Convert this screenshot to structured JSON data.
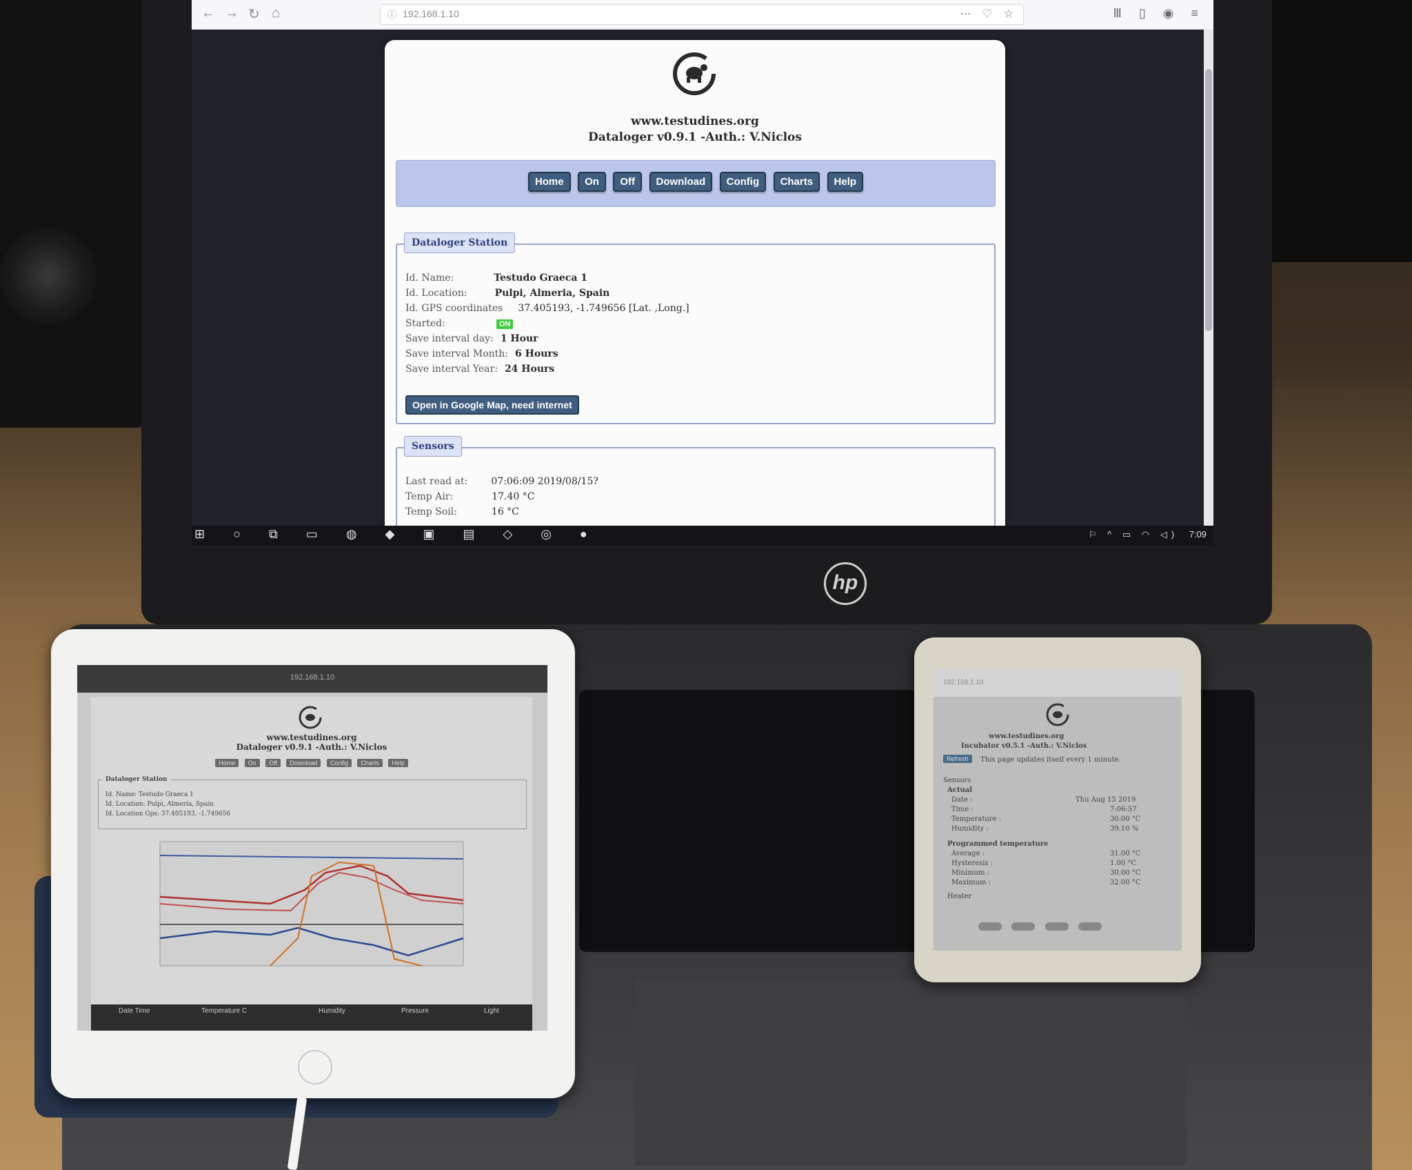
{
  "browser": {
    "url": "192.168.1.10",
    "back_glyph": "←",
    "forward_glyph": "→",
    "reload_glyph": "↻",
    "home_glyph": "⌂",
    "info_glyph": "ⓘ",
    "url_actions": "⋯ ♡ ☆",
    "toolbar_right": "Ⅲ ▯ ◉ ≡"
  },
  "page": {
    "site": "www.testudines.org",
    "subtitle": "Dataloger v0.9.1  -Auth.: V.Niclos",
    "menu": [
      "Home",
      "On",
      "Off",
      "Download",
      "Config",
      "Charts",
      "Help"
    ],
    "station": {
      "legend": "Dataloger Station",
      "rows": [
        {
          "label": "Id. Name:",
          "value": "Testudo Graeca 1"
        },
        {
          "label": "Id. Location:",
          "value": "Pulpi, Almeria, Spain"
        },
        {
          "label": "Id. GPS coordinates",
          "value": "37.405193, -1.749656 [Lat. ,Long.]"
        },
        {
          "label": "Started:",
          "badge": "ON"
        },
        {
          "label": "Save interval day:",
          "value": "1 Hour"
        },
        {
          "label": "Save interval Month:",
          "value": "6 Hours"
        },
        {
          "label": "Save interval Year:",
          "value": "24 Hours"
        }
      ],
      "map_button": "Open in Google Map, need internet"
    },
    "sensors": {
      "legend": "Sensors",
      "rows": [
        {
          "label": "Last read at:",
          "value": "07:06:09 2019/08/15?"
        },
        {
          "label": "Temp Air:",
          "value": "17.40 °C"
        },
        {
          "label": "Temp Soil:",
          "value": "16 °C"
        }
      ]
    }
  },
  "taskbar": {
    "left_icons": "⊞ ○ ⧉ ▭ ◍ ◆ ▣ ▤ ◇ ◎ ●",
    "tray": "⚐ ^ ▭ ◠ ◁)",
    "clock": "7:09"
  },
  "laptop": {
    "brand": "hp"
  },
  "tablet": {
    "url": "192.168.1.10",
    "site": "www.testudines.org",
    "subtitle": "Dataloger v0.9.1  -Auth.: V.Niclos",
    "menu": [
      "Home",
      "On",
      "Off",
      "Download",
      "Config",
      "Charts",
      "Help"
    ],
    "legend": "Dataloger Station",
    "rows": [
      "Id. Name:        Testudo Graeca 1",
      "Id. Location:    Pulpi, Almeria, Spain",
      "Id. Location Gps:  37.405193, -1.749656"
    ],
    "table_headers": [
      "Date Time",
      "Temperature C",
      "Humidity",
      "Pressure",
      "Light"
    ]
  },
  "phone": {
    "url": "192.168.1.10",
    "site": "www.testudines.org",
    "subtitle": "Incubator v0.5.1  -Auth.: V.Niclos",
    "refresh": "Refresh",
    "refresh_note": "This page updates itself every 1 minute.",
    "sensors_label": "Sensors",
    "actual_label": "Actual",
    "actual_rows": [
      {
        "label": "Date :",
        "value": "Thu Aug 15 2019"
      },
      {
        "label": "Time :",
        "value": "7:06:57"
      },
      {
        "label": "Temperature :",
        "value": "30.00 °C"
      },
      {
        "label": "Humidity :",
        "value": "39.10 %"
      }
    ],
    "programmed_label": "Programmed temperature",
    "programmed_rows": [
      {
        "label": "Average :",
        "value": "31.00 °C"
      },
      {
        "label": "Hysteresis :",
        "value": "1.00 °C"
      },
      {
        "label": "Minimum :",
        "value": "30.00 °C"
      },
      {
        "label": "Maximum :",
        "value": "32.00 °C"
      }
    ],
    "heater_label": "Heater"
  }
}
